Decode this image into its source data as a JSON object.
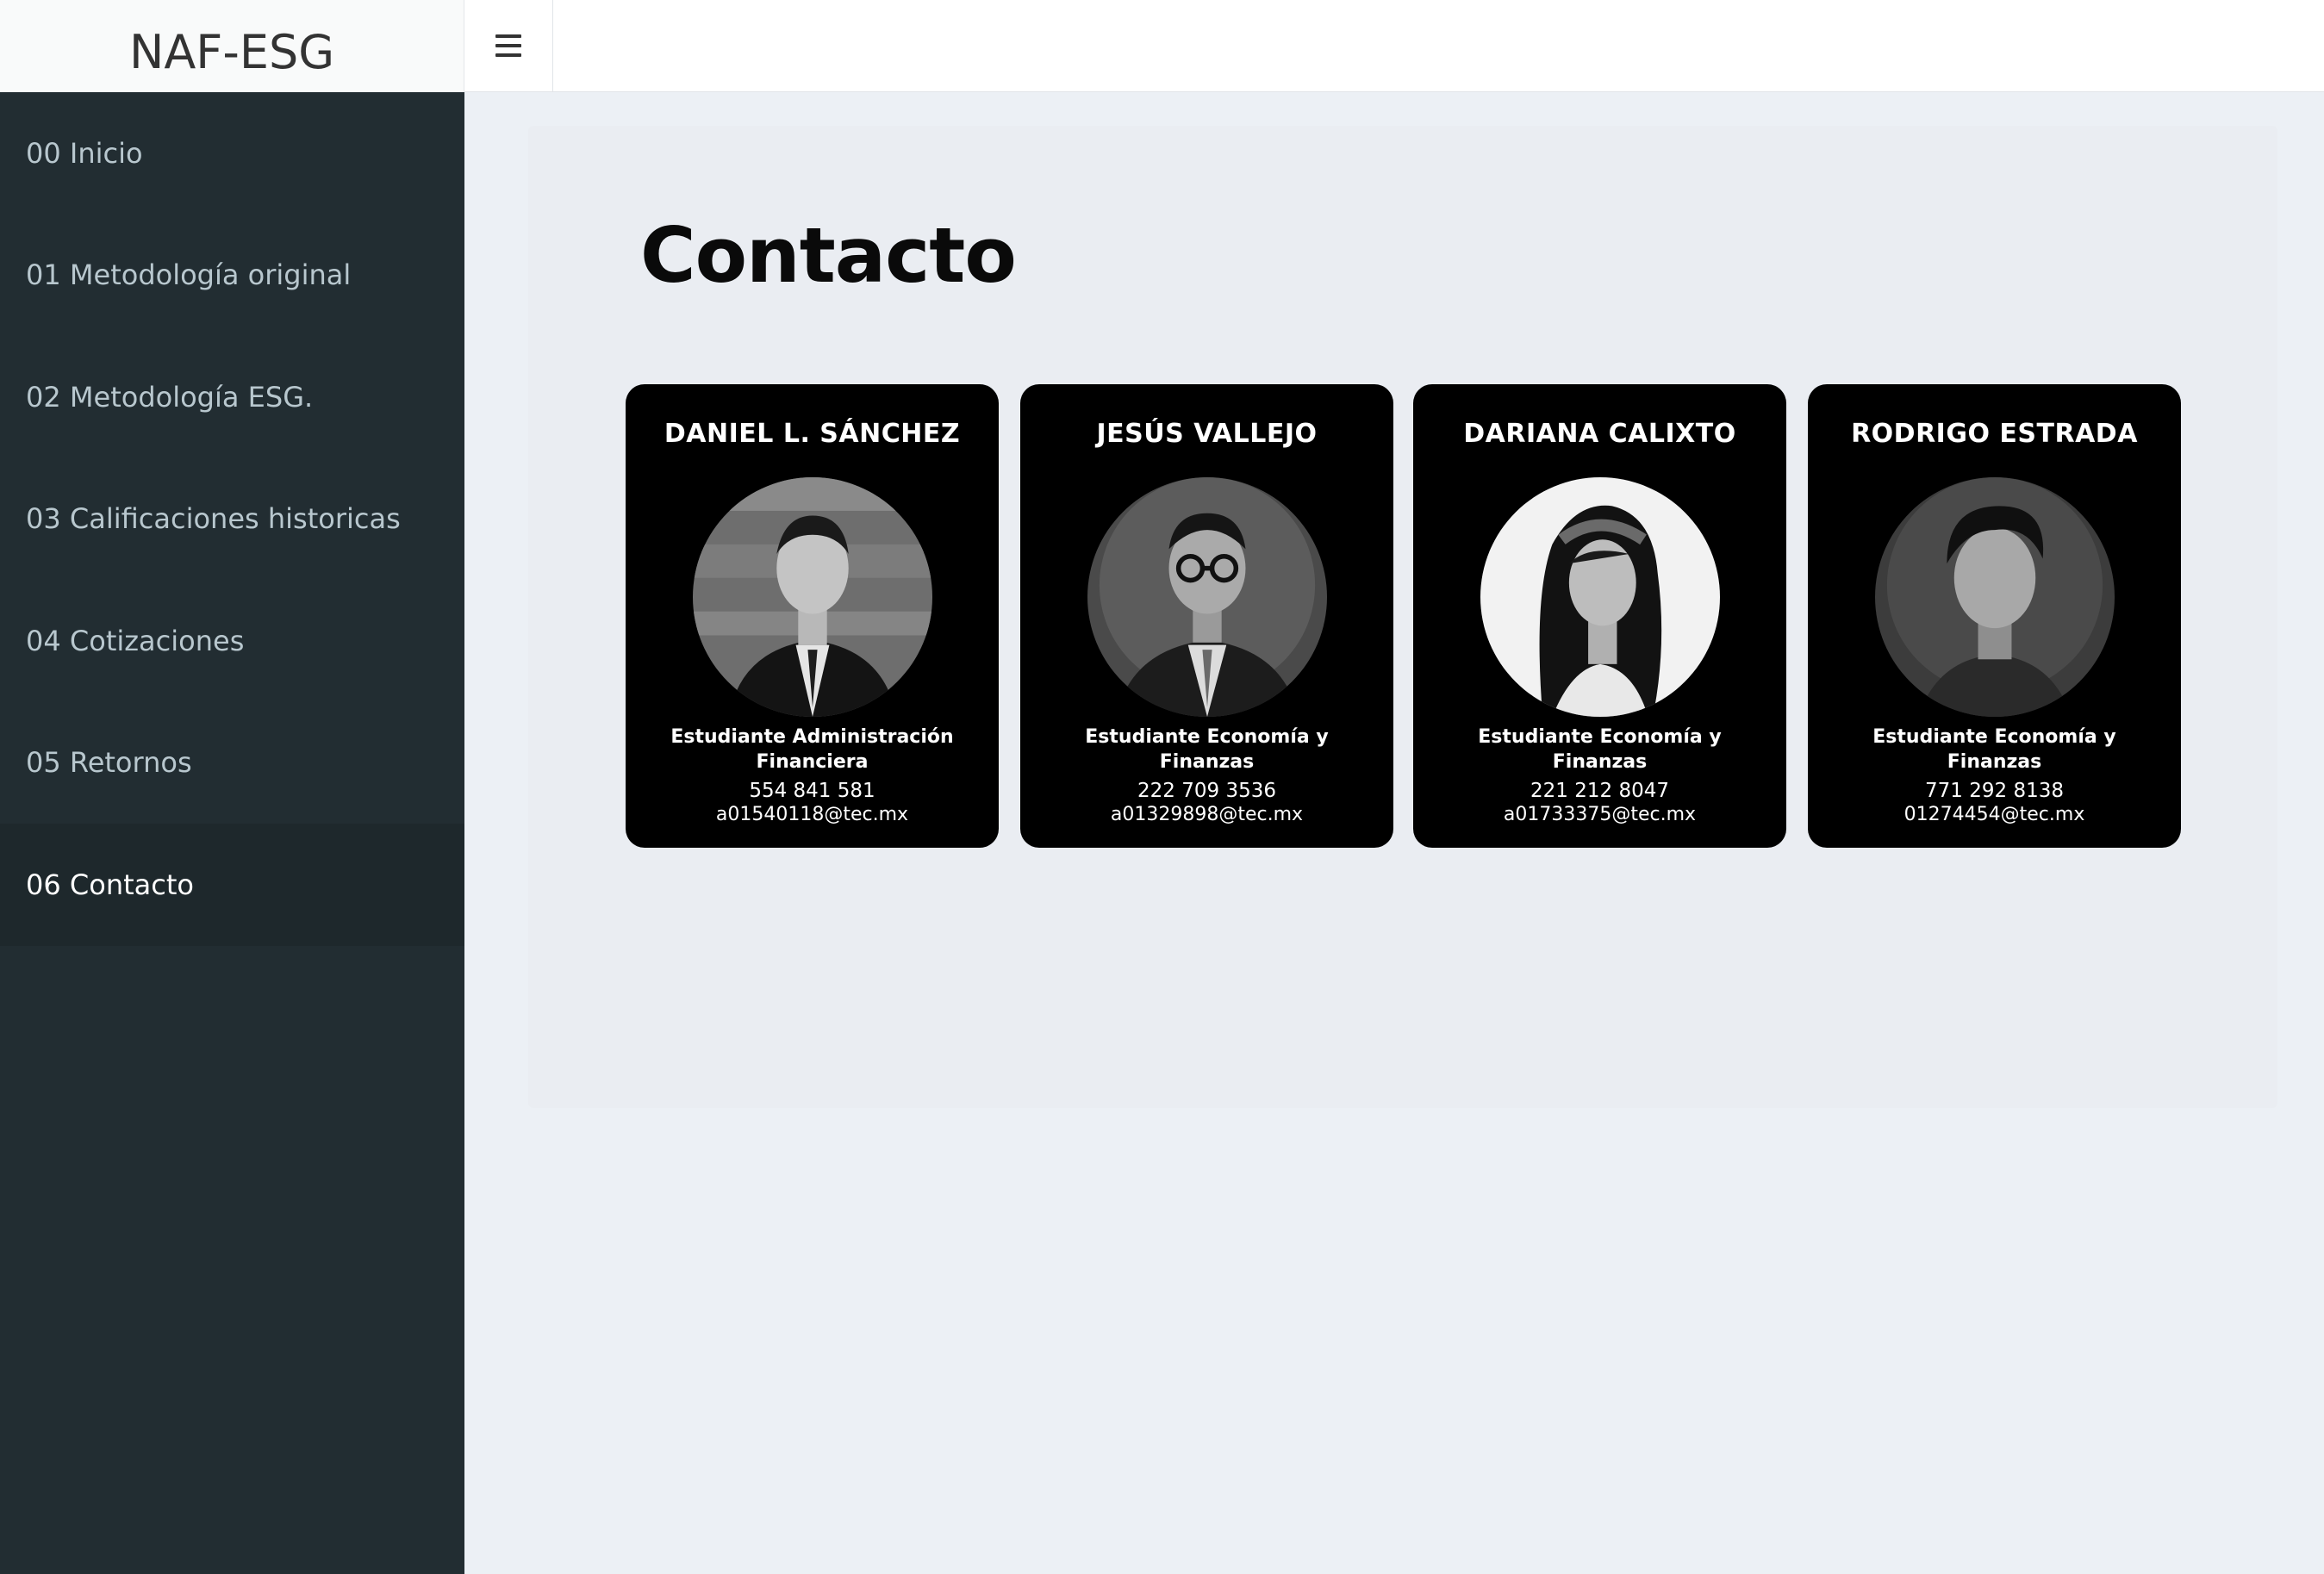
{
  "brand": {
    "title": "NAF-ESG"
  },
  "header": {
    "menu_icon": "hamburger-menu-icon"
  },
  "sidebar": {
    "items": [
      {
        "label": "00 Inicio",
        "active": false
      },
      {
        "label": "01 Metodología original",
        "active": false
      },
      {
        "label": "02 Metodología ESG.",
        "active": false
      },
      {
        "label": "03 Calificaciones historicas",
        "active": false
      },
      {
        "label": "04 Cotizaciones",
        "active": false
      },
      {
        "label": "05 Retornos",
        "active": false
      },
      {
        "label": "06 Contacto",
        "active": true
      }
    ]
  },
  "page": {
    "title": "Contacto"
  },
  "contacts": [
    {
      "name": "DANIEL L. SÁNCHEZ",
      "role": "Estudiante Administración Financiera",
      "phone": "554 841 581",
      "email": "a01540118@tec.mx"
    },
    {
      "name": "JESÚS VALLEJO",
      "role": "Estudiante Economía y Finanzas",
      "phone": "222 709 3536",
      "email": "a01329898@tec.mx"
    },
    {
      "name": "DARIANA CALIXTO",
      "role": "Estudiante Economía y Finanzas",
      "phone": "221 212 8047",
      "email": "a01733375@tec.mx"
    },
    {
      "name": "RODRIGO ESTRADA",
      "role": "Estudiante Economía y Finanzas",
      "phone": "771 292 8138",
      "email": "01274454@tec.mx"
    }
  ],
  "colors": {
    "sidebar_bg": "#222d32",
    "sidebar_active_bg": "#1e282c",
    "sidebar_text": "#b8c7ce",
    "content_bg": "#ecf0f5",
    "card_bg": "#000000"
  }
}
